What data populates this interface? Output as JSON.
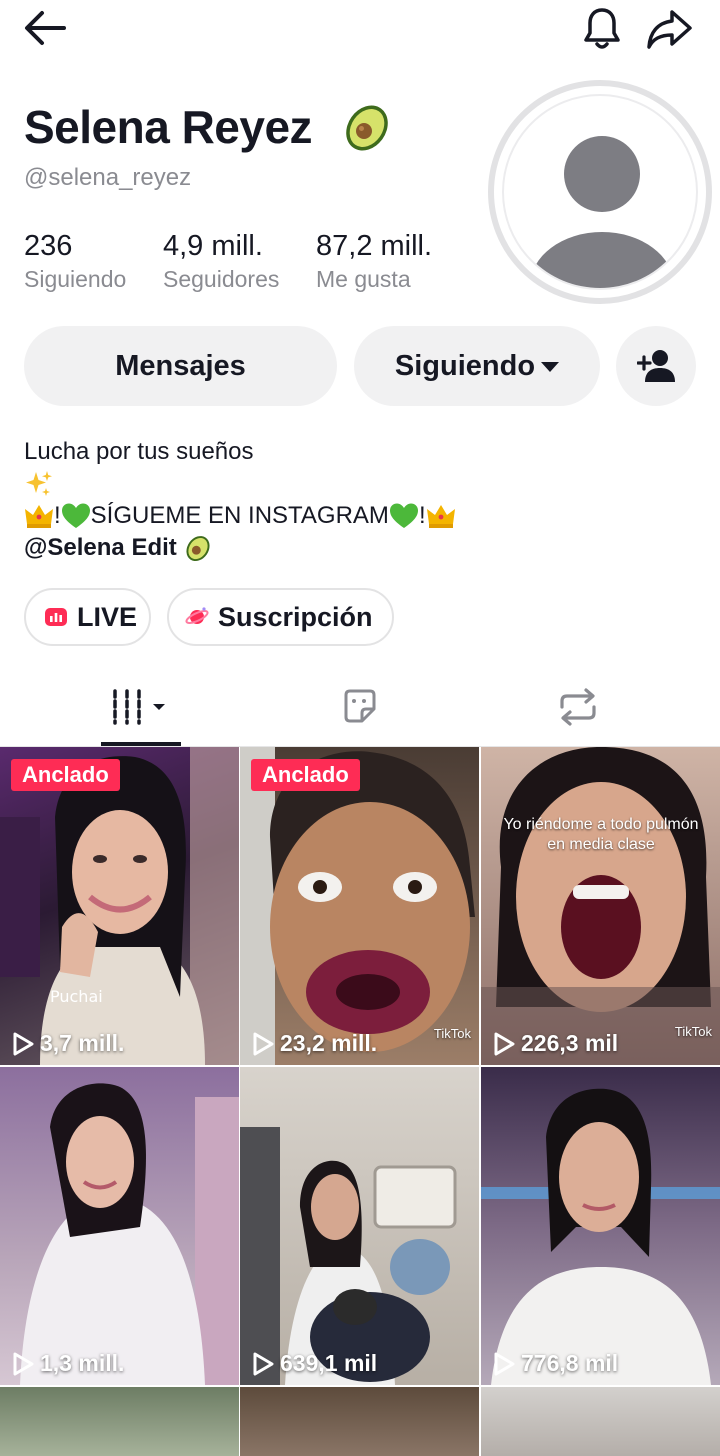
{
  "profile": {
    "name": "Selena Reyez",
    "handle": "@selena_reyez",
    "name_emoji": "avocado-emoji"
  },
  "stats": [
    {
      "value": "236",
      "label": "Siguiendo"
    },
    {
      "value": "4,9 mill.",
      "label": "Seguidores"
    },
    {
      "value": "87,2 mill.",
      "label": "Me gusta"
    }
  ],
  "actions": {
    "message_label": "Mensajes",
    "following_label": "Siguiendo"
  },
  "bio": {
    "line1": "Lucha por tus sueños",
    "line3_text1": "!",
    "line3_text2": "SÍGUEME EN INSTAGRAM",
    "line3_text3": "!",
    "line4": "@Selena Edit"
  },
  "pills": {
    "live": "LIVE",
    "subscription": "Suscripción"
  },
  "videos": [
    {
      "views": "3,7 mill.",
      "pinned": "Anclado"
    },
    {
      "views": "23,2 mill.",
      "pinned": "Anclado",
      "watermark": "TikTok"
    },
    {
      "views": "226,3 mil",
      "overlay": "Yo riéndome a todo pulmón en media clase",
      "watermark": "TikTok"
    },
    {
      "views": "1,3 mill."
    },
    {
      "views": "639,1 mil"
    },
    {
      "views": "776,8 mil"
    }
  ],
  "colors": {
    "accent": "#fe2c55",
    "text": "#161823",
    "secondary": "#8a8b91",
    "button_bg": "#f1f1f2"
  }
}
